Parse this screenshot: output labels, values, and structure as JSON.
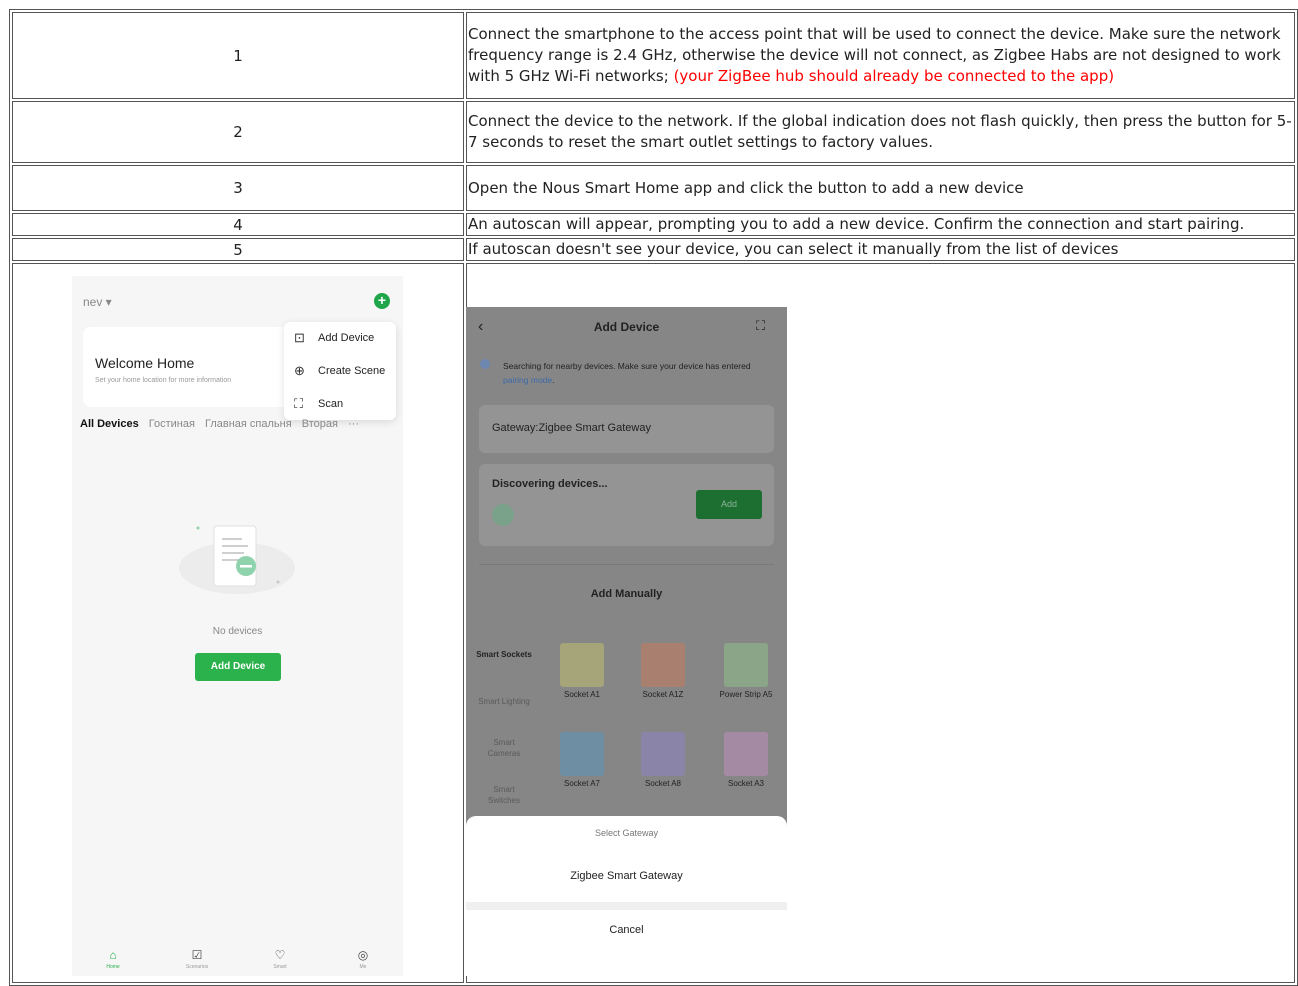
{
  "steps": [
    {
      "num": "1",
      "text": "Connect the smartphone to the access point that will be used to connect the device. Make sure the network frequency range is 2.4 GHz, otherwise the device will not connect, as Zigbee Habs are not designed to work with 5 GHz Wi-Fi networks; ",
      "note": "(your ZigBee hub should already be connected to the app)"
    },
    {
      "num": "2",
      "text": "Connect the device to the network. If the global indication does not flash quickly, then press the button for 5-7 seconds to reset the smart  outlet settings to factory values."
    },
    {
      "num": "3",
      "text": "Open the Nous Smart Home app and click the button to add a new device"
    },
    {
      "num": "4",
      "text": "An autoscan will appear, prompting you to add a new device. Confirm the connection and start pairing."
    },
    {
      "num": "5",
      "text": "If autoscan doesn't see your device, you can select it manually from the list of devices"
    }
  ],
  "phone1": {
    "home_name": "nev ▾",
    "welcome_title": "Welcome Home",
    "welcome_sub": "Set your home location for more information",
    "menu": [
      {
        "icon": "⊡",
        "label": "Add Device"
      },
      {
        "icon": "⊕",
        "label": "Create Scene"
      },
      {
        "icon": "⛶",
        "label": "Scan"
      }
    ],
    "tabs": [
      "All Devices",
      "Гостиная",
      "Главная спальня",
      "Вторая",
      "···"
    ],
    "empty_text": "No devices",
    "add_button": "Add Device",
    "nav": [
      "Home",
      "Scenarios",
      "Smart",
      "Me"
    ]
  },
  "phone2": {
    "title": "Add Device",
    "search_text": "Searching for nearby devices. Make sure your device has entered ",
    "search_link": "pairing mode",
    "search_end": ".",
    "gateway_label": "Gateway:Zigbee Smart Gateway",
    "discovering": "Discovering devices...",
    "add_small": "Add",
    "add_manually": "Add Manually",
    "categories": [
      "Smart Sockets",
      "Smart Lighting",
      "Smart Cameras",
      "Smart Switches"
    ],
    "devices": [
      {
        "name": "Socket A1",
        "color": "#a6a57a"
      },
      {
        "name": "Socket A1Z",
        "color": "#a98070"
      },
      {
        "name": "Power Strip A5",
        "color": "#8aa588"
      },
      {
        "name": "Socket A7",
        "color": "#6d8ea3"
      },
      {
        "name": "Socket A8",
        "color": "#8a84a8"
      },
      {
        "name": "Socket A3",
        "color": "#a58aa3"
      }
    ],
    "sheet_title": "Select Gateway",
    "sheet_option": "Zigbee Smart Gateway",
    "sheet_cancel": "Cancel"
  },
  "accent_green": "#2bb24c",
  "note_color": "#ff0000"
}
